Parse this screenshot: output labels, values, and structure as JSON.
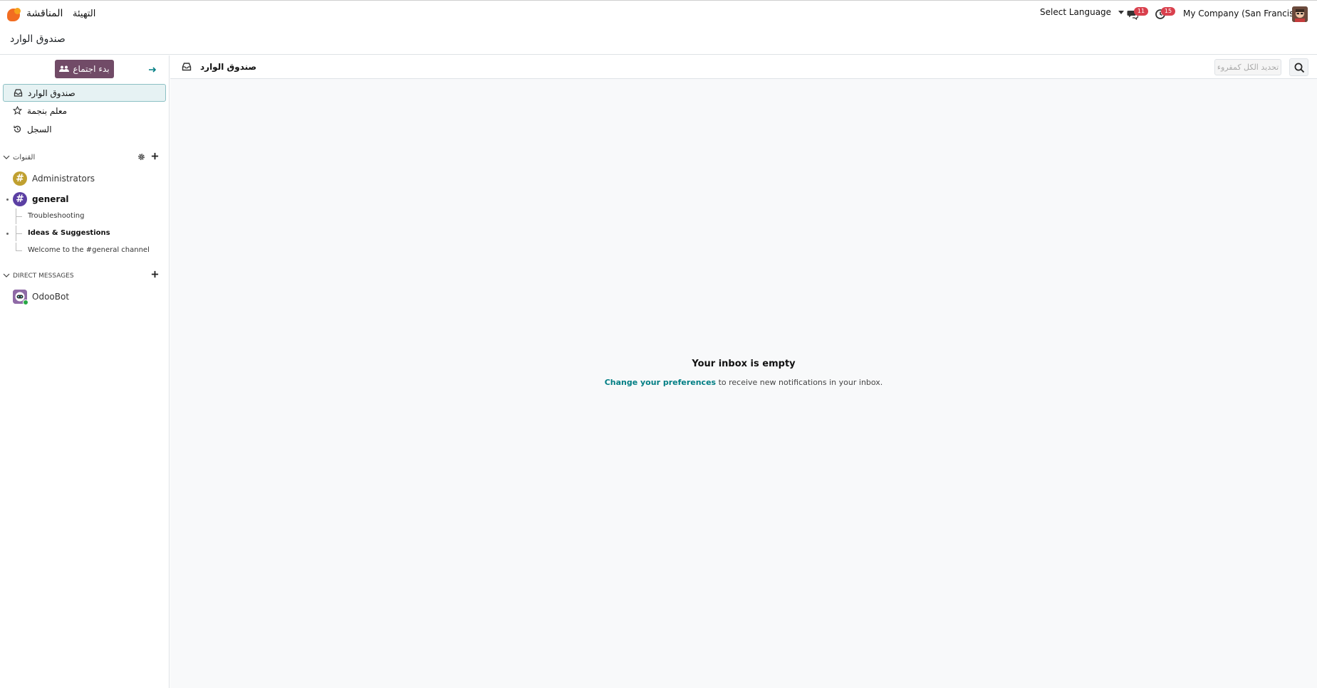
{
  "navbar": {
    "app_name": "المناقشة",
    "config_menu": "التهيئة",
    "language": "Select Language",
    "messages_badge": "11",
    "activities_badge": "15",
    "company": "My Company (San Francisco)"
  },
  "breadcrumb": "صندوق الوارد",
  "sidebar": {
    "start_meeting": "بدء اجتماع",
    "mailboxes": [
      {
        "label": "صندوق الوارد",
        "icon": "inbox-icon",
        "active": true
      },
      {
        "label": "معلم بنجمة",
        "icon": "star-icon",
        "active": false
      },
      {
        "label": "السجل",
        "icon": "history-icon",
        "active": false
      }
    ],
    "channels_header": "القنوات",
    "channels": [
      {
        "label": "Administrators",
        "color": "#c0a030",
        "bold": false
      },
      {
        "label": "general",
        "color": "#5b3fa3",
        "bold": true
      }
    ],
    "sub_channels": [
      {
        "label": "Troubleshooting",
        "bold": false
      },
      {
        "label": "Ideas & Suggestions",
        "bold": true
      },
      {
        "label": "Welcome to the #general channel",
        "bold": false
      }
    ],
    "dm_header": "DIRECT MESSAGES",
    "direct_messages": [
      {
        "label": "OdooBot"
      }
    ]
  },
  "main": {
    "header_title": "صندوق الوارد",
    "mark_all_read": "تحديد الكل كمقروء",
    "empty_title": "Your inbox is empty",
    "empty_link": "Change your preferences",
    "empty_rest": " to receive new notifications in your inbox."
  },
  "colors": {
    "brand": "#714b67",
    "accent": "#017e84",
    "badge": "#d9404d"
  }
}
